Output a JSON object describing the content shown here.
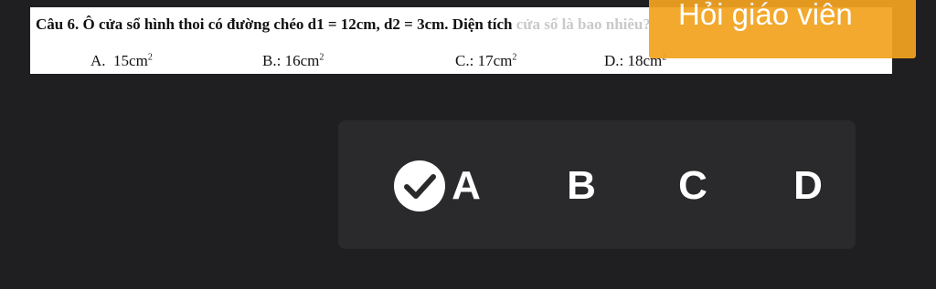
{
  "question": {
    "prefix": "Câu 6. Ô cửa sổ hình thoi có đường chéo d1 = 12cm, d2 = 3cm. Diện tích ",
    "faded_suffix": "cửa sổ là bao nhiêu?",
    "options": [
      {
        "label": "A.",
        "value": "15cm",
        "exp": "2"
      },
      {
        "label": "B.:",
        "value": "16cm",
        "exp": "2"
      },
      {
        "label": "C.:",
        "value": "17cm",
        "exp": "2"
      },
      {
        "label": "D.:",
        "value": "18cm",
        "exp": "2"
      }
    ]
  },
  "ask_teacher": {
    "label": "Hỏi giáo viên",
    "color": "#f2a31f"
  },
  "answers": {
    "choices": [
      "A",
      "B",
      "C",
      "D"
    ],
    "selected": "A",
    "selected_icon": "check-circle-icon"
  },
  "colors": {
    "background": "#1f1f21",
    "panel": "#2a2a2c"
  }
}
